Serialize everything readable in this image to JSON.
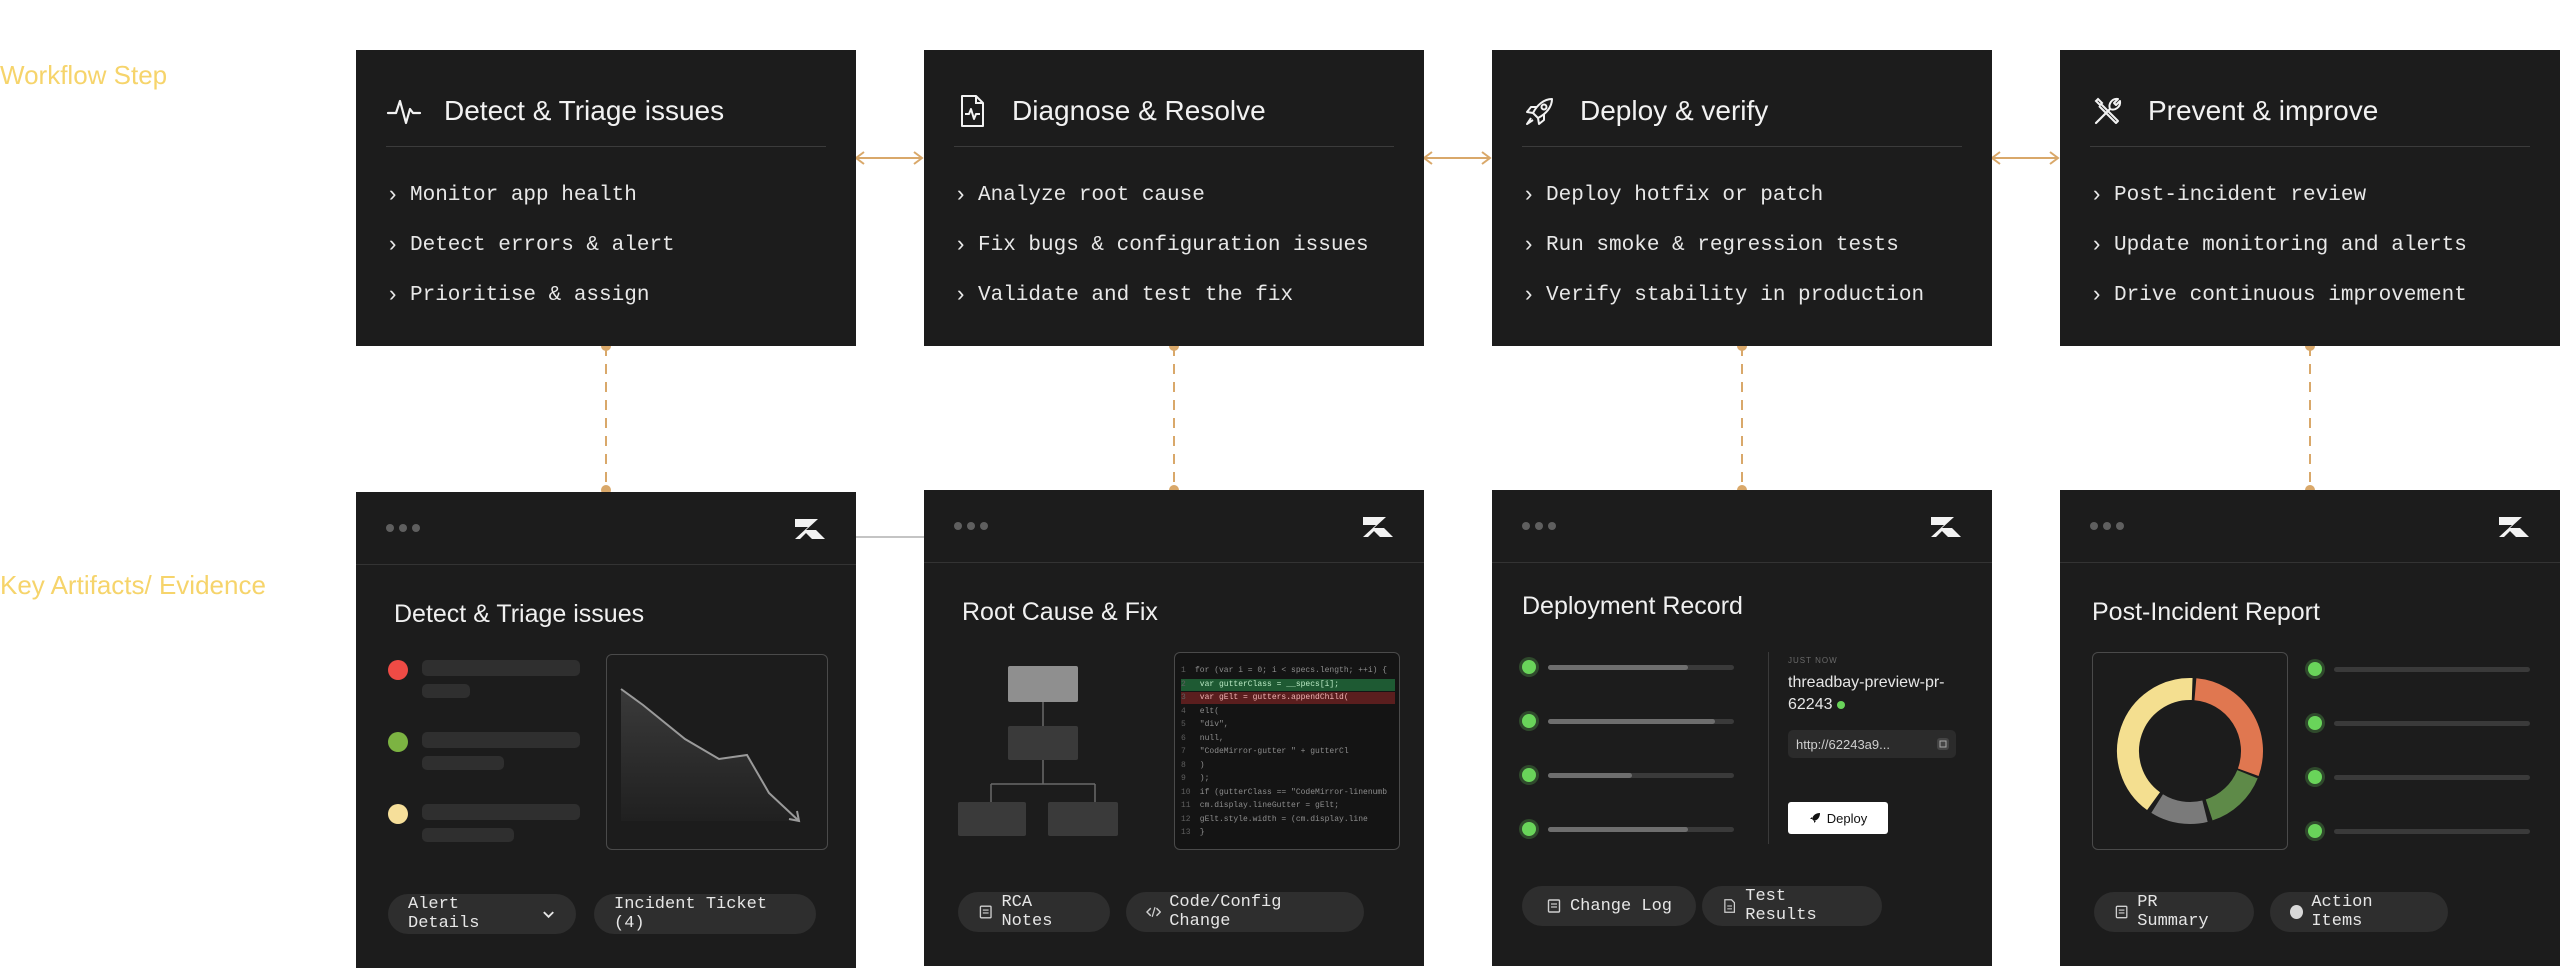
{
  "row_labels": {
    "workflow": "Workflow Step",
    "artifacts": "Key Artifacts/ Evidence"
  },
  "steps": [
    {
      "title": "Detect & Triage issues",
      "icon": "heartbeat-icon",
      "items": [
        "Monitor app health",
        "Detect errors & alert",
        "Prioritise & assign"
      ]
    },
    {
      "title": "Diagnose & Resolve",
      "icon": "document-pulse-icon",
      "items": [
        "Analyze root cause",
        "Fix bugs & configuration issues",
        "Validate and test the fix"
      ]
    },
    {
      "title": "Deploy & verify",
      "icon": "rocket-icon",
      "items": [
        "Deploy hotfix or patch",
        "Run smoke & regression tests",
        "Verify stability in production"
      ]
    },
    {
      "title": "Prevent & improve",
      "icon": "tools-icon",
      "items": [
        "Post-incident review",
        "Update monitoring and alerts",
        "Drive continuous improvement"
      ]
    }
  ],
  "artifacts": {
    "detect": {
      "title": "Detect & Triage issues",
      "status_colors": [
        "#ef4b45",
        "#7cb342",
        "#f6df9a"
      ],
      "btn_alert": "Alert Details",
      "btn_ticket": "Incident Ticket (4)"
    },
    "diagnose": {
      "title": "Root Cause & Fix",
      "code_lines": [
        {
          "n": "1",
          "text": "for (var i = 0; i < specs.length; ++i) {",
          "style": ""
        },
        {
          "n": "2",
          "text": "  var gutterClass = __specs[i];",
          "style": "green"
        },
        {
          "n": "3",
          "text": "  var gElt = gutters.appendChild(",
          "style": "red"
        },
        {
          "n": "4",
          "text": "    elt(",
          "style": ""
        },
        {
          "n": "5",
          "text": "      \"div\",",
          "style": ""
        },
        {
          "n": "6",
          "text": "      null,",
          "style": ""
        },
        {
          "n": "7",
          "text": "      \"CodeMirror-gutter \" + gutterCl",
          "style": ""
        },
        {
          "n": "8",
          "text": "    )",
          "style": ""
        },
        {
          "n": "9",
          "text": "  );",
          "style": ""
        },
        {
          "n": "10",
          "text": "  if (gutterClass == \"CodeMirror-linenumb",
          "style": ""
        },
        {
          "n": "11",
          "text": "    cm.display.lineGutter = gElt;",
          "style": ""
        },
        {
          "n": "12",
          "text": "    gElt.style.width = (cm.display.line",
          "style": ""
        },
        {
          "n": "13",
          "text": "  }",
          "style": ""
        }
      ],
      "btn_rca": "RCA Notes",
      "btn_code": "Code/Config Change"
    },
    "deploy": {
      "title": "Deployment Record",
      "just_now": "JUST NOW",
      "preview_name": "threadbay-preview-pr-62243",
      "url": "http://62243a9...",
      "deploy_label": "Deploy",
      "check_color": "#69d45a",
      "btn_changelog": "Change Log",
      "btn_tests": "Test Results"
    },
    "prevent": {
      "title": "Post-Incident Report",
      "donut_colors": [
        "#e07750",
        "#5e8a48",
        "#7a7a7a",
        "#f4df90"
      ],
      "dot_color": "#69d45a",
      "btn_pr": "PR Summary",
      "btn_actions": "Action Items"
    }
  }
}
